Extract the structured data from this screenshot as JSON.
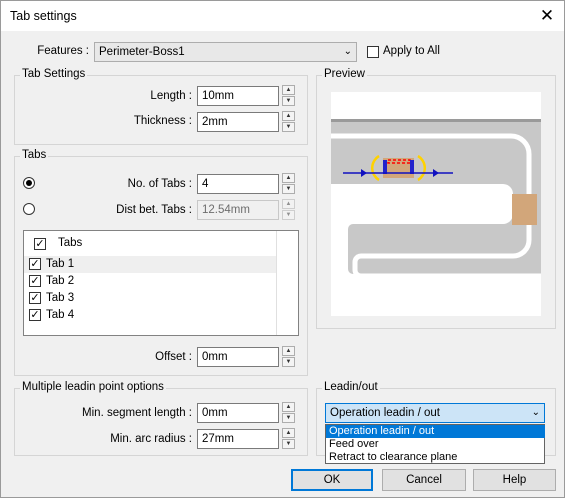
{
  "window": {
    "title": "Tab settings",
    "close_glyph": "✕"
  },
  "features": {
    "label": "Features :",
    "value": "Perimeter-Boss1",
    "apply_all_label": "Apply to All",
    "apply_all_checked": false
  },
  "tab_settings": {
    "group_label": "Tab Settings",
    "length_label": "Length :",
    "length_value": "10mm",
    "thickness_label": "Thickness :",
    "thickness_value": "2mm"
  },
  "tabs": {
    "group_label": "Tabs",
    "no_tabs_label": "No. of Tabs :",
    "no_tabs_value": "4",
    "no_tabs_selected": true,
    "dist_label": "Dist bet. Tabs :",
    "dist_value": "12.54mm",
    "list_header": "Tabs",
    "items": [
      {
        "label": "Tab 1",
        "checked": true
      },
      {
        "label": "Tab 2",
        "checked": true
      },
      {
        "label": "Tab 3",
        "checked": true
      },
      {
        "label": "Tab 4",
        "checked": true
      }
    ],
    "offset_label": "Offset :",
    "offset_value": "0mm"
  },
  "preview": {
    "group_label": "Preview"
  },
  "leadin": {
    "group_label": "Multiple leadin point options",
    "min_segment_label": "Min. segment length :",
    "min_segment_value": "0mm",
    "min_arc_label": "Min. arc radius :",
    "min_arc_value": "27mm"
  },
  "leadin_out": {
    "group_label": "Leadin/out",
    "selected": "Operation leadin / out",
    "options": [
      "Operation leadin / out",
      "Feed over",
      "Retract to clearance plane"
    ]
  },
  "buttons": {
    "ok": "OK",
    "cancel": "Cancel",
    "help": "Help"
  },
  "colors": {
    "accent": "#0078d7",
    "tab_fill": "#d2a67a",
    "part_gray": "#c8c8c8",
    "highlight": "#ffd200"
  }
}
